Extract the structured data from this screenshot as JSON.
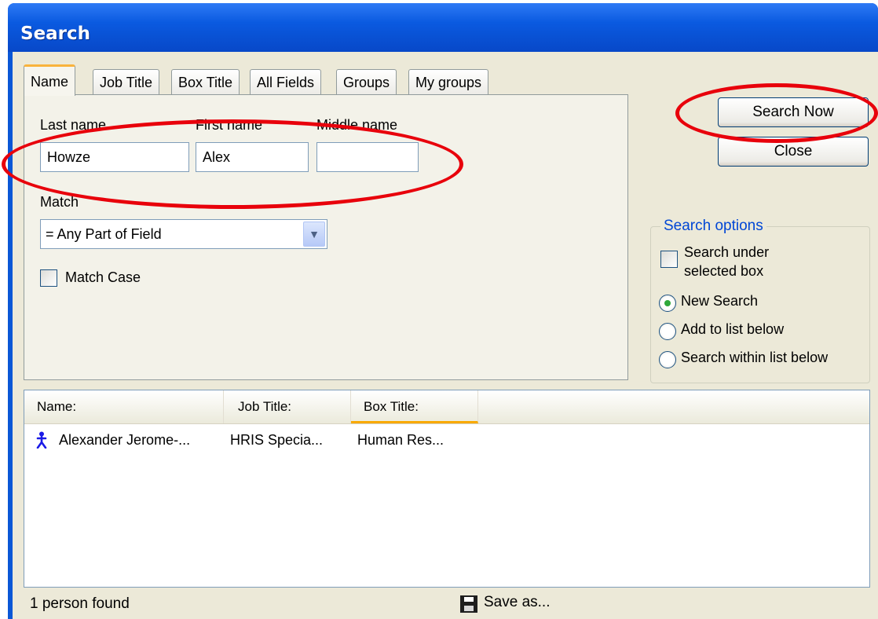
{
  "window": {
    "title": "Search"
  },
  "tabs": [
    {
      "label": "Name",
      "active": true
    },
    {
      "label": "Job Title"
    },
    {
      "label": "Box Title"
    },
    {
      "label": "All Fields"
    },
    {
      "label": "Groups"
    },
    {
      "label": "My groups"
    }
  ],
  "name_tab": {
    "last_name_label": "Last name",
    "first_name_label": "First name",
    "middle_name_label": "Middle name",
    "last_name_value": "Howze",
    "first_name_value": "Alex",
    "middle_name_value": "",
    "match_label": "Match",
    "match_value": "= Any Part of Field",
    "match_case_label": "Match Case",
    "match_case_checked": false
  },
  "buttons": {
    "search_now": "Search Now",
    "close": "Close"
  },
  "search_options": {
    "legend": "Search options",
    "under_box_label_line1": "Search under",
    "under_box_label_line2": "selected box",
    "under_box_checked": false,
    "radios": [
      {
        "label": "New Search",
        "checked": true
      },
      {
        "label": "Add to list below",
        "checked": false
      },
      {
        "label": "Search within list below",
        "checked": false
      }
    ]
  },
  "results": {
    "columns": [
      "Name:",
      "Job Title:",
      "Box Title:"
    ],
    "rows": [
      {
        "name": "Alexander Jerome-...",
        "job_title": "HRIS Specia...",
        "box_title": "Human Res..."
      }
    ]
  },
  "status": {
    "text": "1 person found",
    "save_as": "Save as..."
  },
  "colors": {
    "title_bar": "#0a57d6",
    "dialog_bg": "#ece9d8",
    "annotation": "#e8000b",
    "group_legend": "#0046d5"
  },
  "icons": {
    "person": "person-icon",
    "save": "floppy-disk-icon",
    "dropdown": "chevron-down-icon"
  }
}
